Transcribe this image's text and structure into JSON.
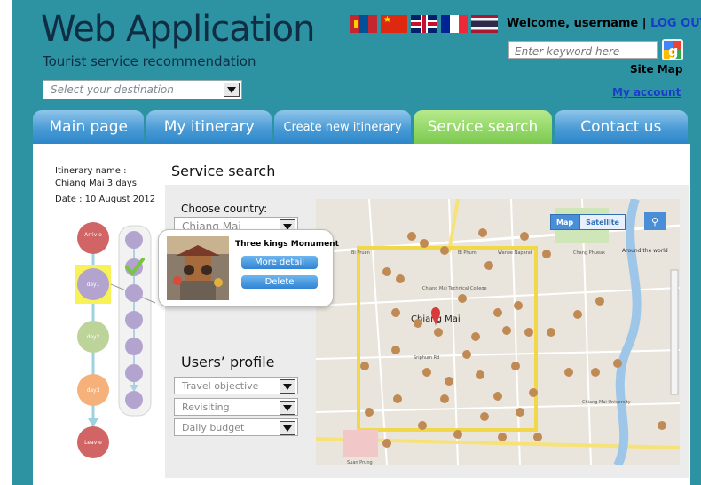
{
  "header": {
    "app_title": "Web Application",
    "subtitle": "Tourist service recommendation",
    "destination_placeholder": "Select your destination",
    "welcome_prefix": "Welcome, username | ",
    "logout_label": "LOG OUT",
    "search_placeholder": "Enter keyword here",
    "sitemap_label": "Site Map",
    "myaccount_label": "My account",
    "flags": [
      "mongolia-flag-icon",
      "china-flag-icon",
      "uk-flag-icon",
      "france-flag-icon",
      "thailand-flag-icon"
    ]
  },
  "tabs": [
    {
      "label": "Main page",
      "active": false
    },
    {
      "label": "My itinerary",
      "active": false
    },
    {
      "label": "Create new itinerary",
      "active": false
    },
    {
      "label": "Service search",
      "active": true
    },
    {
      "label": "Contact us",
      "active": false
    }
  ],
  "itinerary": {
    "name_label": "Itinerary name :",
    "name_value": "Chiang Mai 3 days",
    "date_label": "Date : 10 August 2012",
    "nodes": [
      "Arriv e",
      "day1",
      "day2",
      "day3",
      "Leav e"
    ]
  },
  "service_search": {
    "title": "Service search",
    "choose_country_label": "Choose country:",
    "country_value": "Chiang Mai"
  },
  "popup": {
    "title": "Three kings Monument",
    "more_detail_label": "More detail",
    "delete_label": "Delete"
  },
  "profile": {
    "title": "Users’ profile",
    "travel_objective": "Travel objective",
    "revisiting": "Revisiting",
    "daily_budget": "Daily budget"
  },
  "map": {
    "map_label": "Map",
    "satellite_label": "Satellite",
    "center_label": "Chiang Mai",
    "labels": [
      "Bi Pruen",
      "Bi Phum",
      "Wanee Naparat",
      "Chiang Mai Technical College",
      "Chang Phueak",
      "Suan Prung",
      "Sriphum Rd",
      "Chiang Mai University",
      "Around the world"
    ]
  },
  "colors": {
    "frame": "#2d93a3",
    "tab_blue": "#4a9bd6",
    "tab_green": "#94d86a",
    "link": "#1a3cc9",
    "pin": "#c08a55"
  }
}
